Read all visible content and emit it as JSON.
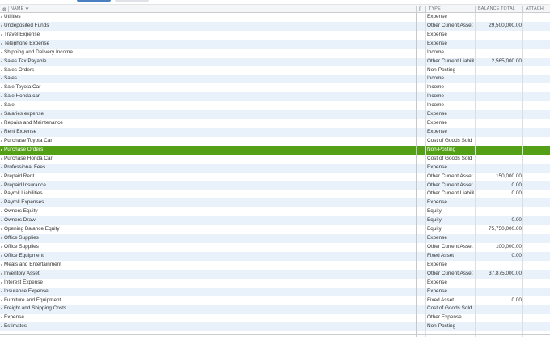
{
  "header": {
    "name": "NAME",
    "type": "TYPE",
    "balance": "BALANCE TOTAL",
    "attach": "ATTACH",
    "gear_icon": "gear-icon",
    "sort_icon": "sort-down-icon",
    "attach_icon": "paperclip-icon"
  },
  "colors": {
    "selected": "#53a016",
    "alt_row": "#e9f2fb"
  },
  "rows": [
    {
      "name": "Utilities",
      "type": "Expense",
      "balance": ""
    },
    {
      "name": "Undeposited Funds",
      "type": "Other Current Asset",
      "balance": "29,500,000.00"
    },
    {
      "name": "Travel Expense",
      "type": "Expense",
      "balance": ""
    },
    {
      "name": "Telephone Expense",
      "type": "Expense",
      "balance": ""
    },
    {
      "name": "Shipping and Delivery Income",
      "type": "Income",
      "balance": ""
    },
    {
      "name": "Sales Tax Payable",
      "type": "Other Current Liability",
      "balance": "2,565,000.00"
    },
    {
      "name": "Sales Orders",
      "type": "Non-Posting",
      "balance": ""
    },
    {
      "name": "Sales",
      "type": "Income",
      "balance": ""
    },
    {
      "name": "Sale Toyota Car",
      "type": "Income",
      "balance": ""
    },
    {
      "name": "Sale Honda car",
      "type": "Income",
      "balance": ""
    },
    {
      "name": "Sale",
      "type": "Income",
      "balance": ""
    },
    {
      "name": "Salaries expense",
      "type": "Expense",
      "balance": ""
    },
    {
      "name": "Repairs and Maintenance",
      "type": "Expense",
      "balance": ""
    },
    {
      "name": "Rent Expense",
      "type": "Expense",
      "balance": ""
    },
    {
      "name": "Purchase Toyota Car",
      "type": "Cost of Goods Sold",
      "balance": ""
    },
    {
      "name": "Purchase Orders",
      "type": "Non-Posting",
      "balance": "",
      "selected": true
    },
    {
      "name": "Purchase Honda Car",
      "type": "Cost of Goods Sold",
      "balance": ""
    },
    {
      "name": "Professional Fees",
      "type": "Expense",
      "balance": ""
    },
    {
      "name": "Prepaid Rent",
      "type": "Other Current Asset",
      "balance": "150,000.00"
    },
    {
      "name": "Prepaid Insurance",
      "type": "Other Current Asset",
      "balance": "0.00"
    },
    {
      "name": "Payroll Liabilities",
      "type": "Other Current Liability",
      "balance": "0.00"
    },
    {
      "name": "Payroll Expenses",
      "type": "Expense",
      "balance": ""
    },
    {
      "name": "Owners Equity",
      "type": "Equity",
      "balance": ""
    },
    {
      "name": "Owners Draw",
      "type": "Equity",
      "balance": "0.00"
    },
    {
      "name": "Opening Balance Equity",
      "type": "Equity",
      "balance": "75,750,000.00"
    },
    {
      "name": "Office Supplies",
      "type": "Expense",
      "balance": ""
    },
    {
      "name": "Office Supplies",
      "type": "Other Current Asset",
      "balance": "100,000.00"
    },
    {
      "name": "Office Equipment",
      "type": "Fixed Asset",
      "balance": "0.00"
    },
    {
      "name": "Meals and Entertainment",
      "type": "Expense",
      "balance": ""
    },
    {
      "name": "Inventory Asset",
      "type": "Other Current Asset",
      "balance": "37,875,000.00"
    },
    {
      "name": "Interest Expense",
      "type": "Expense",
      "balance": ""
    },
    {
      "name": "Insurance Expense",
      "type": "Expense",
      "balance": ""
    },
    {
      "name": "Furniture and Equipment",
      "type": "Fixed Asset",
      "balance": "0.00"
    },
    {
      "name": "Freight and Shipping Costs",
      "type": "Cost of Goods Sold",
      "balance": ""
    },
    {
      "name": "Expense",
      "type": "Other Expense",
      "balance": ""
    },
    {
      "name": "Estimates",
      "type": "Non-Posting",
      "balance": ""
    }
  ]
}
